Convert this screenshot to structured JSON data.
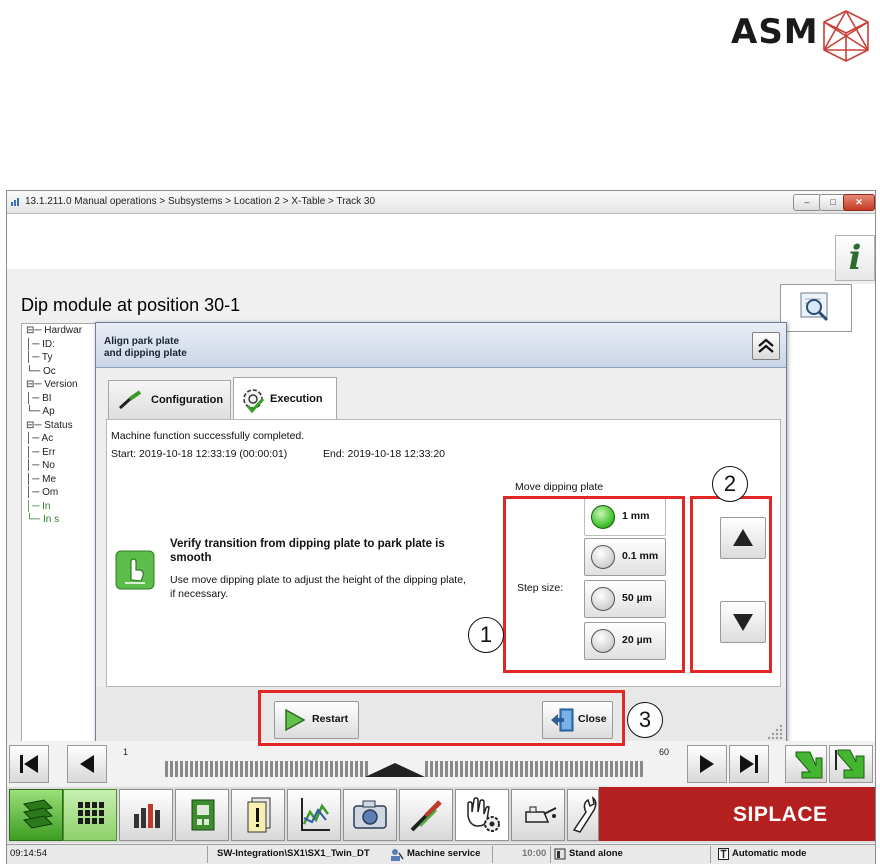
{
  "brand": {
    "logo_text": "ASM",
    "footer_brand": "SIPLACE"
  },
  "window": {
    "title": "13.1.211.0 Manual operations > Subsystems > Location 2 > X-Table > Track 30",
    "controls": {
      "minimize": "–",
      "maximize": "□",
      "close": "✕"
    }
  },
  "page": {
    "title": "Dip module at position 30-1",
    "info_button": "i"
  },
  "tree": [
    {
      "text": "⊟─ Hardwar",
      "green": false
    },
    {
      "text": "      │─ ID:",
      "green": false
    },
    {
      "text": "      │─ Ty",
      "green": false
    },
    {
      "text": "      └─ Oc",
      "green": false
    },
    {
      "text": "⊟─ Version",
      "green": false
    },
    {
      "text": "      │─ BI",
      "green": false
    },
    {
      "text": "      └─ Ap",
      "green": false
    },
    {
      "text": "⊟─ Status",
      "green": false
    },
    {
      "text": "      │─ Ac",
      "green": false
    },
    {
      "text": "      │─ Err",
      "green": false
    },
    {
      "text": "      │─ No",
      "green": false
    },
    {
      "text": "      │─ Me",
      "green": false
    },
    {
      "text": "      │─ Om",
      "green": false
    },
    {
      "text": "      │─ In",
      "green": true
    },
    {
      "text": "      └─ In s",
      "green": true
    }
  ],
  "dialog": {
    "title_line1": "Align park plate",
    "title_line2": "and dipping plate",
    "tabs": {
      "configuration": "Configuration",
      "execution": "Execution"
    },
    "status_message": "Machine function successfully completed.",
    "start_text": "Start: 2019-10-18 12:33:19 (00:00:01)",
    "end_text": "End: 2019-10-18 12:33:20",
    "instruction_title": "Verify transition from dipping plate to park plate is smooth",
    "instruction_body": "Use move dipping plate to adjust the height of the dipping plate, if necessary.",
    "move_label": "Move dipping plate",
    "step_size_label": "Step size:",
    "step_options": [
      "1 mm",
      "0.1 mm",
      "50 µm",
      "20 µm"
    ],
    "selected_step": "1 mm",
    "buttons": {
      "restart": "Restart",
      "close": "Close"
    }
  },
  "callouts": [
    "1",
    "2",
    "3"
  ],
  "timeline": {
    "left_label": "1",
    "right_label": "60"
  },
  "statusbar": {
    "time": "09:14:54",
    "path": "SW-Integration\\SX1\\SX1_Twin_DT",
    "mode": "Machine service",
    "clock": "10:00",
    "standalone": "Stand alone",
    "auto": "Automatic mode"
  },
  "colors": {
    "annotation_red": "#e32626",
    "siplace_red": "#b4201f",
    "selected_green": "#3ec22a"
  }
}
